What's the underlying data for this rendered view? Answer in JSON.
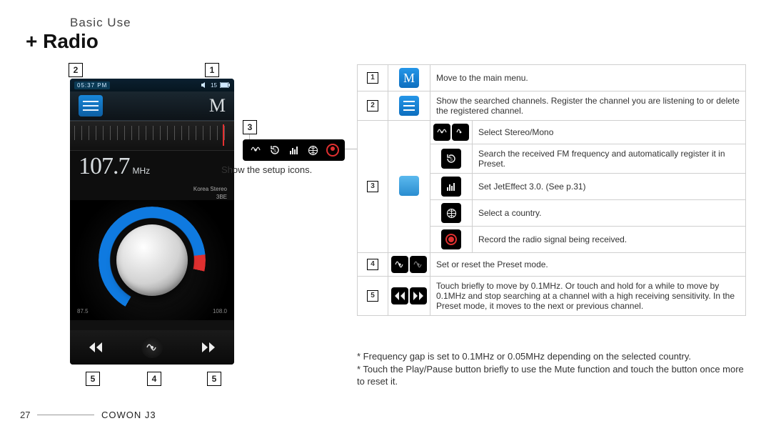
{
  "header": {
    "section": "Basic  Use",
    "title": "+ Radio"
  },
  "device": {
    "clock": "05:37 PM",
    "vol_label": "15",
    "freq_value": "107.7",
    "freq_unit": "MHz",
    "meta1": "Korea  Stereo",
    "meta2": "3BE",
    "band_low": "87.5",
    "band_high": "108.0"
  },
  "setup_icons_label": "Show the setup icons.",
  "callouts": {
    "c1": "1",
    "c2": "2",
    "c3": "3",
    "c4": "4",
    "c5": "5"
  },
  "table": {
    "r1": "Move to the main menu.",
    "r2": "Show the searched channels. Register the channel you are listening to or delete the registered channel.",
    "r3a": "Select Stereo/Mono",
    "r3b": "Search the received FM frequency and automatically register it in Preset.",
    "r3c": "Set JetEffect 3.0. (See p.31)",
    "r3d": "Select a country.",
    "r3e": "Record the radio signal being received.",
    "r4": "Set or reset the Preset mode.",
    "r5": "Touch briefly to move by 0.1MHz. Or touch and hold for a while to move by 0.1MHz and stop searching at a channel with a high receiving sensitivity. In the Preset mode, it moves to the next or previous channel."
  },
  "notes": {
    "n1": "* Frequency gap is set to 0.1MHz or 0.05MHz depending on the selected country.",
    "n2": "* Touch the Play/Pause button briefly to use the Mute function and touch the button once more to reset it."
  },
  "footer": {
    "page": "27",
    "model": "COWON J3"
  }
}
